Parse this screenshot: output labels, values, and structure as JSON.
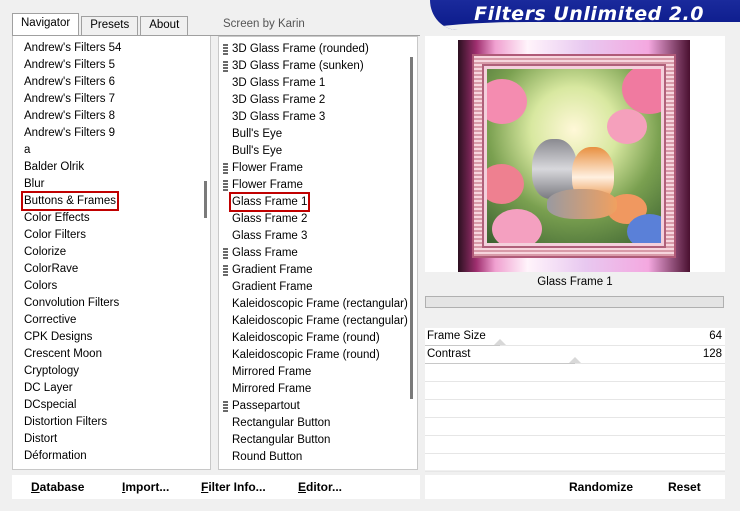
{
  "tabs": [
    "Navigator",
    "Presets",
    "About"
  ],
  "screen_by": "Screen by Karin",
  "app_title": "Filters Unlimited 2.0",
  "categories": [
    "Andrew's Filters 54",
    "Andrew's Filters 5",
    "Andrew's Filters 6",
    "Andrew's Filters 7",
    "Andrew's Filters 8",
    "Andrew's Filters 9",
    "a",
    "Balder Olrik",
    "Blur",
    "Buttons & Frames",
    "Color Effects",
    "Color Filters",
    "Colorize",
    "ColorRave",
    "Colors",
    "Convolution Filters",
    "Corrective",
    "CPK Designs",
    "Crescent Moon",
    "Cryptology",
    "DC Layer",
    "DCspecial",
    "Distortion Filters",
    "Distort",
    "Déformation"
  ],
  "selected_category": "Buttons & Frames",
  "filters": [
    {
      "label": "3D Glass Frame (rounded)",
      "marker": true
    },
    {
      "label": "3D Glass Frame (sunken)",
      "marker": true
    },
    {
      "label": "3D Glass Frame 1",
      "marker": false
    },
    {
      "label": "3D Glass Frame 2",
      "marker": false
    },
    {
      "label": "3D Glass Frame 3",
      "marker": false
    },
    {
      "label": "Bull's Eye",
      "marker": false
    },
    {
      "label": "Bull's Eye",
      "marker": false
    },
    {
      "label": "Flower Frame",
      "marker": true
    },
    {
      "label": "Flower Frame",
      "marker": true
    },
    {
      "label": "Glass Frame 1",
      "marker": false
    },
    {
      "label": "Glass Frame 2",
      "marker": false
    },
    {
      "label": "Glass Frame 3",
      "marker": false
    },
    {
      "label": "Glass Frame",
      "marker": true
    },
    {
      "label": "Gradient Frame",
      "marker": true
    },
    {
      "label": "Gradient Frame",
      "marker": false
    },
    {
      "label": "Kaleidoscopic Frame (rectangular)",
      "marker": false
    },
    {
      "label": "Kaleidoscopic Frame (rectangular)",
      "marker": false
    },
    {
      "label": "Kaleidoscopic Frame (round)",
      "marker": false
    },
    {
      "label": "Kaleidoscopic Frame (round)",
      "marker": false
    },
    {
      "label": "Mirrored Frame",
      "marker": false
    },
    {
      "label": "Mirrored Frame",
      "marker": false
    },
    {
      "label": "Passepartout",
      "marker": true
    },
    {
      "label": "Rectangular Button",
      "marker": false
    },
    {
      "label": "Rectangular Button",
      "marker": false
    },
    {
      "label": "Round Button",
      "marker": false
    }
  ],
  "selected_filter": "Glass Frame 1",
  "preview_caption": "Glass Frame 1",
  "params": [
    {
      "label": "Frame Size",
      "value": "64",
      "fraction": 0.25
    },
    {
      "label": "Contrast",
      "value": "128",
      "fraction": 0.5
    }
  ],
  "buttons_left": [
    {
      "label": "Database",
      "underline": "D",
      "rest": "atabase"
    },
    {
      "label": "Import...",
      "underline": "I",
      "rest": "mport..."
    },
    {
      "label": "Filter Info...",
      "underline": "F",
      "rest": "ilter Info..."
    },
    {
      "label": "Editor...",
      "underline": "E",
      "rest": "ditor..."
    }
  ],
  "buttons_right": [
    "Randomize",
    "Reset"
  ],
  "colors": {
    "banner": "#0b1a8a",
    "selection_outline": "#c00000"
  }
}
